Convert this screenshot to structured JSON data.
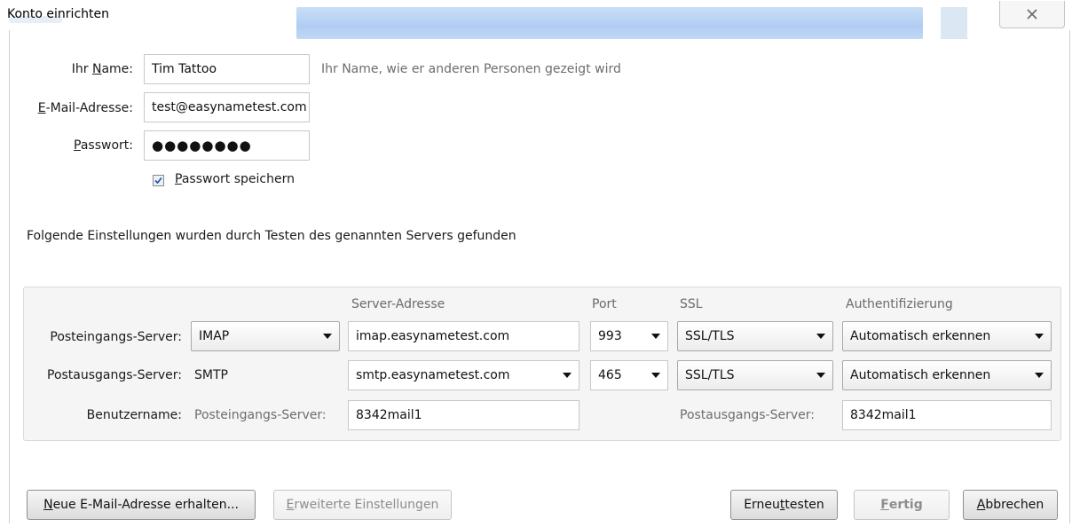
{
  "window": {
    "title": "Konto einrichten",
    "close_glyph": "✕"
  },
  "account": {
    "name_label_pre": "Ihr ",
    "name_label_u": "N",
    "name_label_post": "ame:",
    "name_value": "Tim Tattoo",
    "name_hint": "Ihr Name, wie er anderen Personen gezeigt wird",
    "email_label_u": "E",
    "email_label_post": "-Mail-Adresse:",
    "email_value": "test@easynametest.com",
    "password_label_u": "P",
    "password_label_post": "asswort:",
    "password_value": "●●●●●●●●",
    "save_password_checked": true,
    "save_password_u": "P",
    "save_password_post": "asswort speichern"
  },
  "status_text": "Folgende Einstellungen wurden durch Testen des genannten Servers gefunden",
  "server_table": {
    "headers": {
      "address": "Server-Adresse",
      "port": "Port",
      "ssl": "SSL",
      "auth": "Authentifizierung"
    },
    "incoming": {
      "label": "Posteingangs-Server:",
      "protocol": "IMAP",
      "address": "imap.easynametest.com",
      "port": "993",
      "ssl": "SSL/TLS",
      "auth": "Automatisch erkennen"
    },
    "outgoing": {
      "label": "Postausgangs-Server:",
      "protocol": "SMTP",
      "address": "smtp.easynametest.com",
      "port": "465",
      "ssl": "SSL/TLS",
      "auth": "Automatisch erkennen"
    },
    "username": {
      "label": "Benutzername:",
      "incoming_label": "Posteingangs-Server:",
      "incoming_value": "8342mail1",
      "outgoing_label": "Postausgangs-Server:",
      "outgoing_value": "8342mail1"
    }
  },
  "buttons": {
    "new_email_u": "N",
    "new_email_post": "eue E-Mail-Adresse erhalten...",
    "advanced_u": "E",
    "advanced_post": "rweiterte Einstellungen",
    "retest_pre": "Erneu",
    "retest_u": "t",
    "retest_post": " testen",
    "done_u": "F",
    "done_post": "ertig",
    "cancel_u": "A",
    "cancel_post": "bbrechen"
  }
}
